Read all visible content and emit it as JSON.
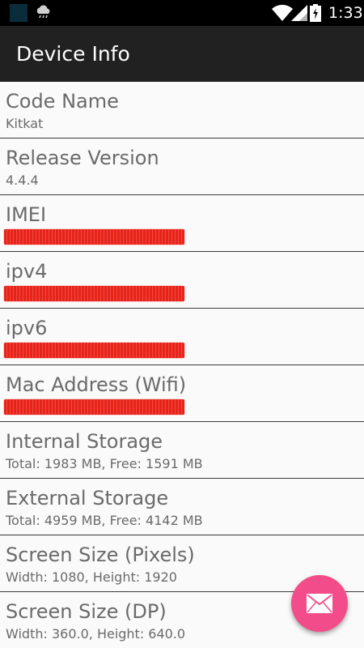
{
  "status_bar": {
    "time": "1:33",
    "icons": [
      "app-notification-icon",
      "weather-icon",
      "wifi-icon",
      "signal-icon",
      "battery-charging-icon"
    ]
  },
  "app_bar": {
    "title": "Device Info"
  },
  "items": [
    {
      "label": "Code Name",
      "value": "Kitkat"
    },
    {
      "label": "Release Version",
      "value": "4.4.4"
    },
    {
      "label": "IMEI",
      "redacted": true
    },
    {
      "label": "ipv4",
      "redacted": true
    },
    {
      "label": "ipv6",
      "redacted": true
    },
    {
      "label": "Mac Address (Wifi)",
      "redacted": true
    },
    {
      "label": "Internal Storage",
      "value": "Total: 1983 MB, Free: 1591 MB"
    },
    {
      "label": "External Storage",
      "value": "Total: 4959 MB, Free: 4142 MB"
    },
    {
      "label": "Screen Size (Pixels)",
      "value": "Width: 1080, Height: 1920"
    },
    {
      "label": "Screen Size (DP)",
      "value": "Width: 360.0, Height: 640.0"
    }
  ],
  "fab": {
    "icon": "mail-icon",
    "color": "#f24d8a"
  },
  "colors": {
    "app_bar": "#212121",
    "status_bar": "#000000",
    "redaction": "#e8231a",
    "text": "#6a6a6a"
  }
}
